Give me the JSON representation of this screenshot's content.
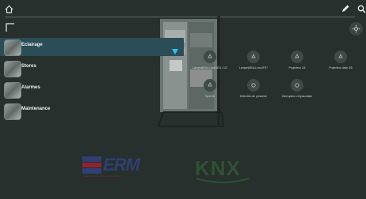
{
  "top_bar": {
    "home_icon": "home-icon",
    "edit_icon": "pencil-icon",
    "search_icon": "search-icon"
  },
  "sidebar": {
    "items": [
      {
        "label": "Eclairage",
        "selected": true,
        "icon": "dropper-icon"
      },
      {
        "label": "Stores",
        "selected": false
      },
      {
        "label": "Alarmes",
        "selected": false
      },
      {
        "label": "Maintenance",
        "selected": false
      }
    ]
  },
  "tiles": [
    {
      "label": "Lampe@DALI-mor2431 / 1/2"
    },
    {
      "label": "Lampe@DALI-mor2F37"
    },
    {
      "label": "Projecteur 1/4"
    },
    {
      "label": "Projecteur dalle 3/8"
    },
    {
      "label": "Spot 06"
    },
    {
      "label": "Détection de présence"
    },
    {
      "label": "Interrupteur crépusculaire"
    }
  ],
  "logos": {
    "erm": "ERM",
    "erm_tagline": "Automatismes Industriels Formation",
    "knx": "KNX"
  },
  "colors": {
    "background": "#27302c",
    "selected_row": "#2b4d57",
    "accent_icon": "#2ec4f0"
  }
}
